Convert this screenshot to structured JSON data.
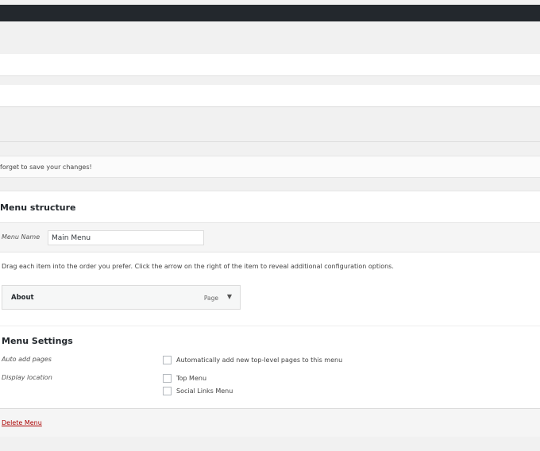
{
  "notice": {
    "text": "forget to save your changes!"
  },
  "menu_structure": {
    "title": "Menu structure",
    "name_label": "Menu Name",
    "name_value": "Main Menu",
    "drag_help": "Drag each item into the order you prefer. Click the arrow on the right of the item to reveal additional configuration options.",
    "items": [
      {
        "title": "About",
        "type": "Page",
        "arrow": "▼"
      }
    ]
  },
  "menu_settings": {
    "title": "Menu Settings",
    "auto_add_label": "Auto add pages",
    "auto_add_option": "Automatically add new top-level pages to this menu",
    "display_location_label": "Display location",
    "locations": [
      "Top Menu",
      "Social Links Menu"
    ]
  },
  "footer": {
    "delete_label": "Delete Menu"
  },
  "colors": {
    "admin_bar": "#23282d",
    "delete_link": "#a00000",
    "background": "#f1f1f1"
  }
}
